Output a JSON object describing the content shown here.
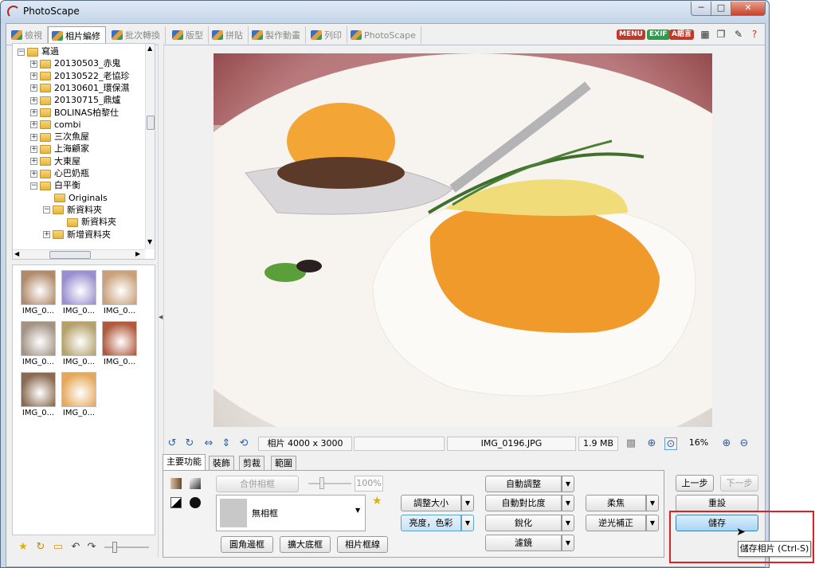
{
  "window": {
    "title": "PhotoScape",
    "min": "─",
    "max": "□",
    "close": "✕"
  },
  "tabs": [
    {
      "label": "檢視",
      "active": false
    },
    {
      "label": "相片編修",
      "active": true
    },
    {
      "label": "批次轉換",
      "active": false
    },
    {
      "label": "版型",
      "active": false
    },
    {
      "label": "拼貼",
      "active": false
    },
    {
      "label": "製作動畫",
      "active": false
    },
    {
      "label": "列印",
      "active": false
    },
    {
      "label": "PhotoScape",
      "active": false
    }
  ],
  "header_badges": {
    "menu": "MENU",
    "exif": "EXIF",
    "lang": "A語言"
  },
  "colors": {
    "accent": "#3c7fb1",
    "badge": "#c0392b",
    "highlight": "#e02020"
  },
  "tree": [
    {
      "label": "寫過",
      "depth": 0,
      "expander": "−"
    },
    {
      "label": "20130503_赤鬼",
      "depth": 1,
      "expander": "+"
    },
    {
      "label": "20130522_老協珍",
      "depth": 1,
      "expander": "+"
    },
    {
      "label": "20130601_環保濕",
      "depth": 1,
      "expander": "+"
    },
    {
      "label": "20130715_鼎爐",
      "depth": 1,
      "expander": "+"
    },
    {
      "label": "BOLINAS柏黎仕",
      "depth": 1,
      "expander": "+"
    },
    {
      "label": "combi",
      "depth": 1,
      "expander": "+"
    },
    {
      "label": "三次魚屋",
      "depth": 1,
      "expander": "+"
    },
    {
      "label": "上海顧家",
      "depth": 1,
      "expander": "+"
    },
    {
      "label": "大東屋",
      "depth": 1,
      "expander": "+"
    },
    {
      "label": "心巴奶瓶",
      "depth": 1,
      "expander": "+"
    },
    {
      "label": "白平衡",
      "depth": 1,
      "expander": "−"
    },
    {
      "label": "Originals",
      "depth": 2,
      "expander": ""
    },
    {
      "label": "新資料夾",
      "depth": 2,
      "expander": "−"
    },
    {
      "label": "新資料夾",
      "depth": 3,
      "expander": ""
    },
    {
      "label": "新增資料夾",
      "depth": 2,
      "expander": "+"
    }
  ],
  "thumbnails": [
    {
      "caption": "IMG_0...",
      "color": "#b08a6a"
    },
    {
      "caption": "IMG_0...",
      "color": "#9a8fcf"
    },
    {
      "caption": "IMG_0...",
      "color": "#c9a07a"
    },
    {
      "caption": "IMG_0...",
      "color": "#a39384"
    },
    {
      "caption": "IMG_0...",
      "color": "#b5a16a"
    },
    {
      "caption": "IMG_0...",
      "color": "#b0593c"
    },
    {
      "caption": "IMG_0...",
      "color": "#8a6a50"
    },
    {
      "caption": "IMG_0...",
      "color": "#e6a95b"
    }
  ],
  "status": {
    "size": "相片 4000 x 3000",
    "blank": "",
    "filename": "IMG_0196.JPG",
    "filesize": "1.9 MB",
    "zoom": "16%"
  },
  "subtabs": [
    {
      "label": "主要功能",
      "active": true
    },
    {
      "label": "裝飾",
      "active": false
    },
    {
      "label": "剪裁",
      "active": false
    },
    {
      "label": "範圍",
      "active": false
    }
  ],
  "frame": {
    "merge_label": "合併相框",
    "percent": "100%",
    "selected": "無相框",
    "round_corner": "圓角邊框",
    "expand": "擴大底框",
    "photo_border": "相片框線"
  },
  "adjust": {
    "resize": "調整大小",
    "bright": "亮度，色彩",
    "auto_adjust": "自動調整",
    "auto_contrast": "自動對比度",
    "sharpen": "銳化",
    "filter": "濾鏡",
    "soften": "柔焦",
    "backlight": "逆光補正"
  },
  "actions": {
    "undo": "上一步",
    "redo": "下一步",
    "reset": "重設",
    "save": "儲存",
    "tooltip": "儲存相片 (Ctrl-S)"
  }
}
